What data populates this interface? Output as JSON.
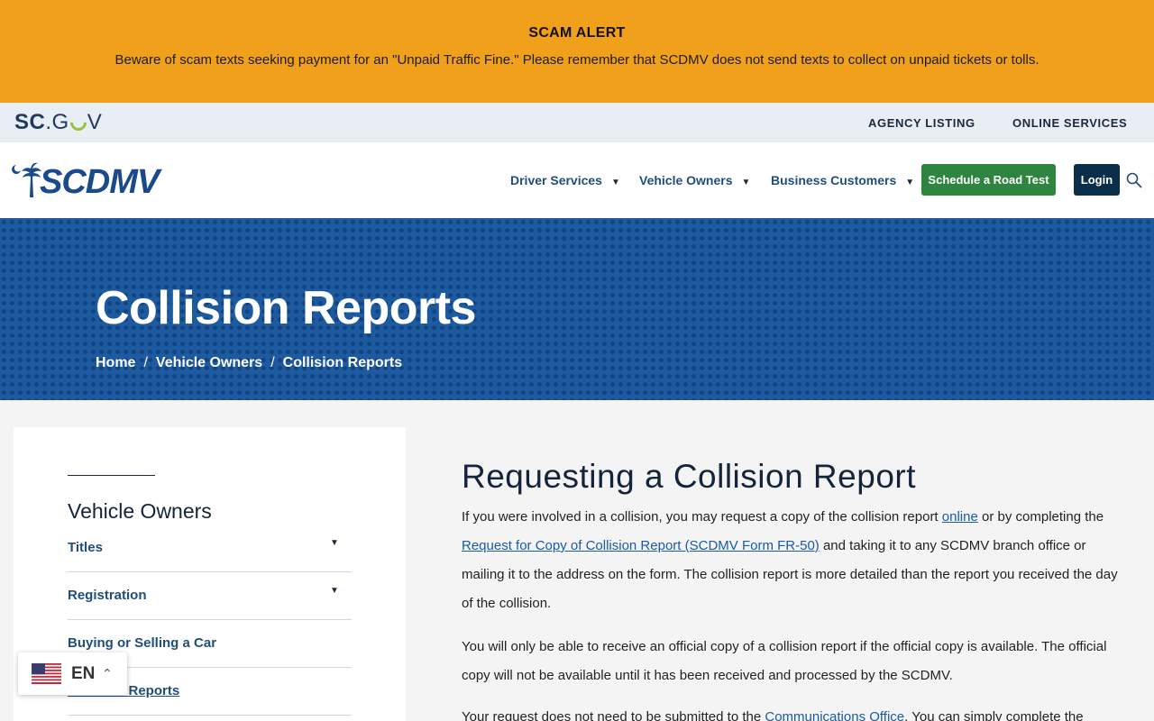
{
  "alert": {
    "title": "SCAM ALERT",
    "text": "Beware of scam texts seeking payment for an \"Unpaid Traffic Fine.\" Please remember that SCDMV does not send texts to collect on unpaid tickets or tolls."
  },
  "govbar": {
    "logo_sc": "SC",
    "logo_dot": ".G",
    "logo_v": "V",
    "links": [
      "AGENCY LISTING",
      "ONLINE SERVICES"
    ]
  },
  "header": {
    "logo_text": "SCDMV",
    "nav": [
      "Driver Services",
      "Vehicle Owners",
      "Business Customers"
    ],
    "caret": "▼",
    "road_test_label": "Schedule a Road Test",
    "login_label": "Login"
  },
  "hero": {
    "title": "Collision Reports",
    "breadcrumb": [
      "Home",
      "Vehicle Owners",
      "Collision Reports"
    ],
    "separator": "/"
  },
  "sidebar": {
    "heading": "Vehicle Owners",
    "items": [
      "Titles",
      "Registration",
      "Buying or Selling a Car",
      "Collision Reports"
    ]
  },
  "language": {
    "code": "EN",
    "caret": "⌃"
  },
  "content": {
    "heading": "Requesting a Collision Report",
    "p1_a": "If you were involved in a collision, you may request a copy of the collision report ",
    "p1_link1": "online",
    "p1_b": " or by completing the ",
    "p1_link2": "Request for Copy of Collision Report (SCDMV Form FR-50)",
    "p1_c": " and taking it to any SCDMV branch office or mailing it to the address on the form. The collision report is more detailed than the report you received the day of the collision.",
    "p2": "You will only be able to receive an official copy of a collision report if the official copy is available. The official copy will not be available until it has been received and processed by the SCDMV.",
    "p3_a": "Your request does not need to be submitted to the ",
    "p3_link": "Communications Office",
    "p3_b": ". You can simply complete the"
  },
  "colors": {
    "alert_bg": "#f0a01a",
    "brand_blue": "#1a4a8c",
    "hero_blue": "#1d5aa0",
    "road_test_green": "#2e8540",
    "login_navy": "#0b2f4a"
  }
}
